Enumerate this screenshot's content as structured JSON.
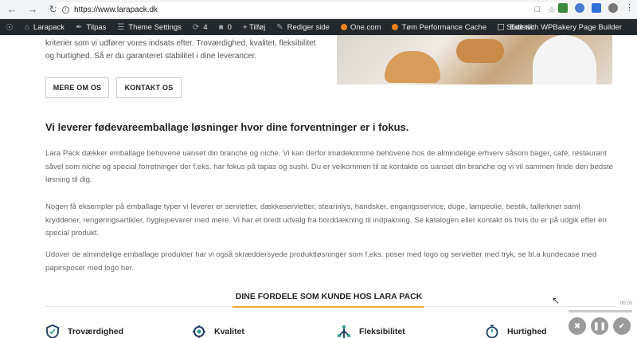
{
  "browser": {
    "url": "https://www.larapack.dk"
  },
  "adminbar": {
    "site": "Larapack",
    "customize": "Tilpas",
    "theme_settings": "Theme Settings",
    "updates": "4",
    "comments": "0",
    "new": "+ Tilføj",
    "edit": "Rediger side",
    "onecom": "One.com",
    "cache": "Tøm Performance Cache",
    "statistik": "Statistik",
    "wpbakery": "Edit with WPBakery Page Builder"
  },
  "intro": {
    "text": "kriterier som vi udfører vores indsats efter. Troværdighed, kvalitet, fleksibilitet og hurtighed. Så er du garanteret stabilitet i dine leverancer."
  },
  "buttons": {
    "about": "MERE OM OS",
    "contact": "KONTAKT OS"
  },
  "main": {
    "heading": "Vi leverer fødevareemballage løsninger hvor dine forventninger er i fokus.",
    "p1": "Lara Pack dækker emballage behovene uanset din branche og niche. Vi kan derfor imødekomme behovene hos de almindelige erhverv såsom bager, café, restaurant såvel som niche og special forretninger der f.eks. har fokus på tapas og sushi. Du er velkommen til at kontakte os uanset din branche og vi vil sammen finde den bedste løsning til dig.",
    "p2": "Nogen få eksempler på emballage typer vi leverer er servietter, dækkeservietter, stearinlys, handsker, engangsservice, duge, lampeolie, bestik, tallerkner samt krydderier, rengøringsartikler, hygiejnevarer med mere. Vi har et bredt udvalg fra borddækning til indpakning. Se katalogen eller kontakt os hvis du er på udgik efter en special produkt.",
    "p3": "Udover de almindelige emballage produkter har vi også skræddersyede produktløsninger som f.eks. poser med logo og servietter med tryk, se bl.a kundecase med papirsposer med logo her."
  },
  "benefits": {
    "title": "DINE FORDELE SOM KUNDE HOS LARA PACK",
    "items": [
      {
        "label": "Troværdighed"
      },
      {
        "label": "Kvalitet"
      },
      {
        "label": "Fleksibilitet"
      },
      {
        "label": "Hurtighed"
      }
    ]
  },
  "recorder": {
    "time": "00:00"
  },
  "colors": {
    "accent": "#f0a830",
    "adminbar": "#23282d",
    "onecom_dot": "#f0821e"
  }
}
